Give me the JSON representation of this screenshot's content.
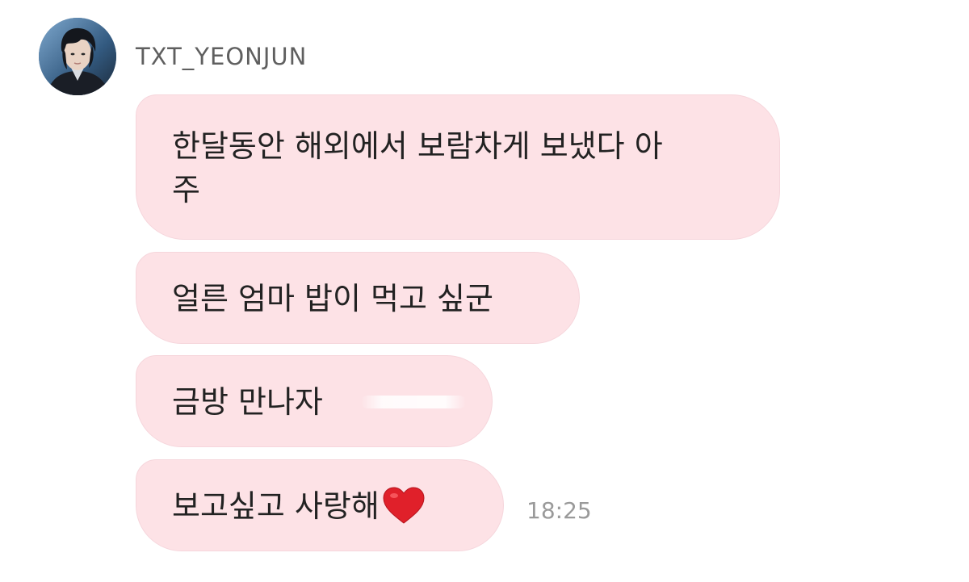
{
  "sender": {
    "name": "TXT_YEONJUN",
    "avatar": "profile-photo"
  },
  "messages": [
    {
      "lines": [
        "한달동안 해외에서 보람차게 보냈다 아",
        "주"
      ]
    },
    {
      "text": "얼른 엄마 밥이 먹고 싶군"
    },
    {
      "text": "금방 만나자"
    },
    {
      "text": "보고싶고 사랑해",
      "emoji": "red-heart-icon"
    }
  ],
  "timestamp": "18:25",
  "colors": {
    "bubble": "#fde2e6",
    "heart": "#e0202a",
    "timestamp": "#9a9a9a",
    "name": "#5f5f5f"
  }
}
